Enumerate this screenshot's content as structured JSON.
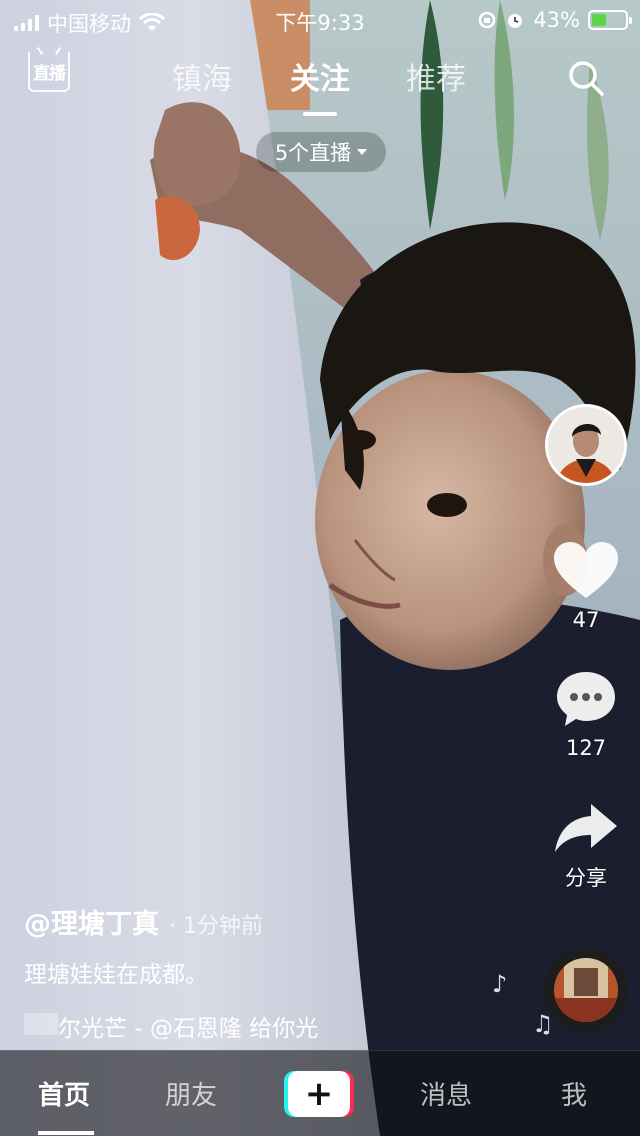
{
  "status_bar": {
    "carrier": "中国移动",
    "time": "下午9:33",
    "battery": "43%",
    "battery_level": 0.43
  },
  "top_nav": {
    "live_label": "直播",
    "tabs": [
      "镇海",
      "关注",
      "推荐"
    ],
    "active_tab": "关注",
    "live_pill": "5个直播"
  },
  "actions": {
    "likes": "47",
    "comments": "127",
    "share": "分享"
  },
  "post": {
    "author": "@理塘丁真",
    "time_ago": "· 1分钟前",
    "caption": "理塘娃娃在成都。",
    "music": "尔光芒 - @石恩隆   给你光"
  },
  "tab_bar": {
    "items": [
      "首页",
      "朋友",
      "消息",
      "我"
    ],
    "active": "首页"
  },
  "colors": {
    "accent_cyan": "#25f4ee",
    "accent_red": "#fe2c55",
    "battery_green": "#5fd34a"
  }
}
